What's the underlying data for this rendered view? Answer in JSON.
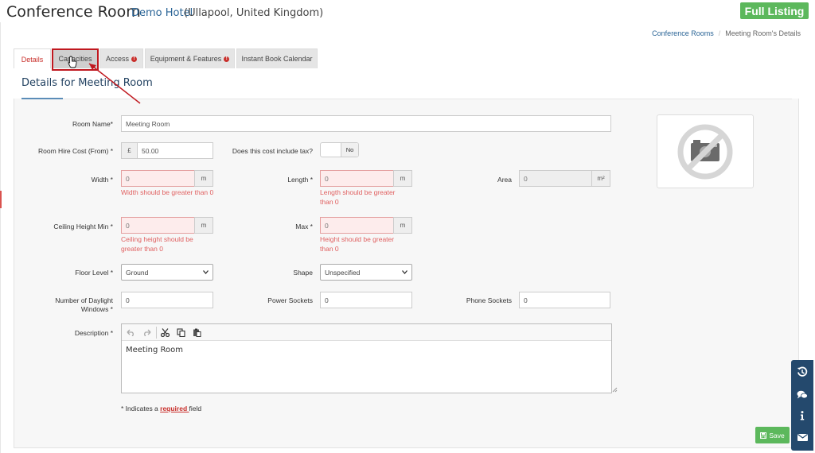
{
  "header": {
    "title": "Conference Room",
    "hotel_link": "Demo Hotel",
    "hotel_location": "(Ullapool, United Kingdom)",
    "full_listing": "Full Listing"
  },
  "breadcrumb": {
    "parent": "Conference Rooms",
    "separator": "/",
    "current": "Meeting Room's Details"
  },
  "tabs": [
    {
      "label": "Details",
      "active": true
    },
    {
      "label": "Capacities"
    },
    {
      "label": "Access",
      "error": "!"
    },
    {
      "label": "Equipment & Features",
      "error": "!"
    },
    {
      "label": "Instant Book Calendar"
    }
  ],
  "panel": {
    "title": "Details for Meeting Room"
  },
  "form": {
    "room_name": {
      "label": "Room Name*",
      "value": "Meeting Room"
    },
    "hire_cost": {
      "label": "Room Hire Cost (From) *",
      "currency": "£",
      "value": "50.00"
    },
    "includes_tax": {
      "label": "Does this cost include tax?",
      "state": "No"
    },
    "width": {
      "label": "Width *",
      "value": "0",
      "unit": "m",
      "error": "Width should be greater than 0"
    },
    "length": {
      "label": "Length *",
      "value": "0",
      "unit": "m",
      "error": "Length should be greater than 0"
    },
    "area": {
      "label": "Area",
      "value": "0",
      "unit": "m²"
    },
    "ceiling_min": {
      "label": "Ceiling Height Min *",
      "value": "0",
      "unit": "m",
      "error": "Ceiling height should be greater than 0"
    },
    "ceiling_max": {
      "label": "Max *",
      "value": "0",
      "unit": "m",
      "error": "Height should be greater than 0"
    },
    "floor_level": {
      "label": "Floor Level *",
      "value": "Ground"
    },
    "shape": {
      "label": "Shape",
      "value": "Unspecified"
    },
    "daylight_windows": {
      "label_line1": "Number of Daylight",
      "label_line2": "Windows *",
      "value": "0"
    },
    "power_sockets": {
      "label": "Power Sockets",
      "value": "0"
    },
    "phone_sockets": {
      "label": "Phone Sockets",
      "value": "0"
    },
    "description": {
      "label": "Description *",
      "value": "Meeting Room"
    }
  },
  "required_note": {
    "prefix": "* Indicates a ",
    "word": "required ",
    "suffix": "field"
  },
  "save_label": "Save",
  "colors": {
    "accent_green": "#5cb85c",
    "error_red": "#c9302c",
    "sidebar": "#24496d"
  },
  "sidebar_icons": [
    "history-icon",
    "chat-icon",
    "info-icon",
    "mail-icon"
  ]
}
